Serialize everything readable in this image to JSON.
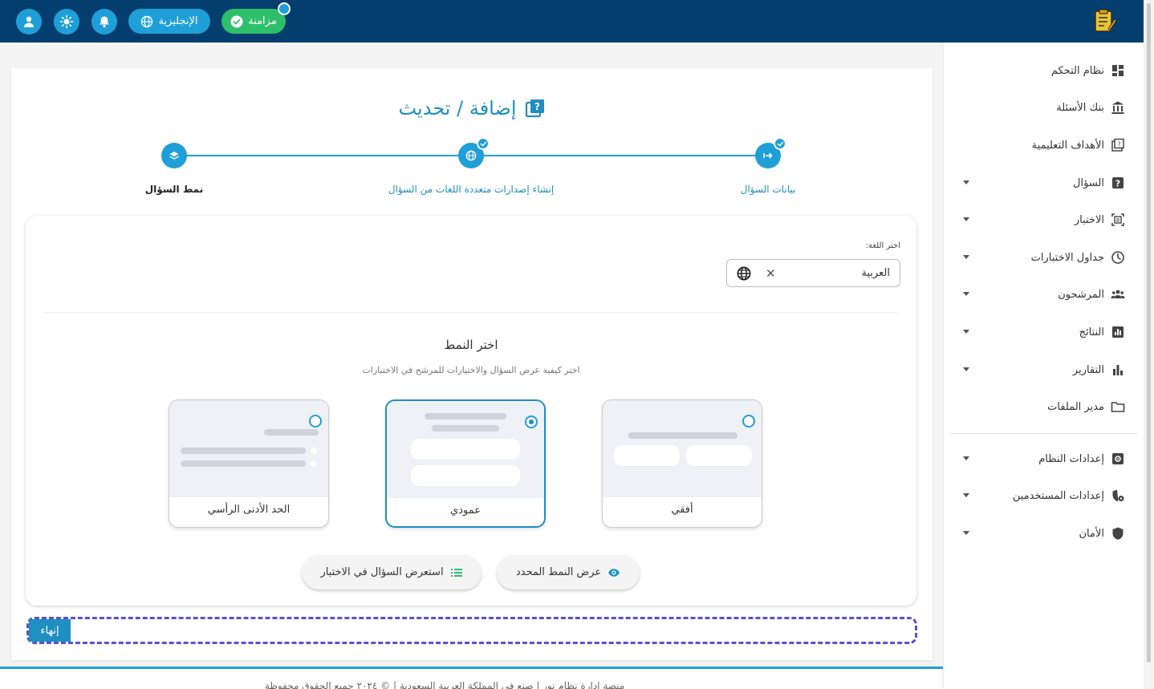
{
  "topbar": {
    "sync_label": "مزامنة",
    "language_label": "الإنجليزية",
    "icons": [
      "user-icon",
      "sun-icon",
      "bell-icon",
      "globe-icon",
      "check-icon"
    ]
  },
  "sidebar": {
    "items": [
      {
        "label": "نظام التحكم",
        "icon": "dashboard-icon",
        "expandable": false
      },
      {
        "label": "بنك الأسئلة",
        "icon": "bank-icon",
        "expandable": false
      },
      {
        "label": "الأهداف التعليمية",
        "icon": "objectives-icon",
        "expandable": false
      },
      {
        "label": "السؤال",
        "icon": "question-icon",
        "expandable": true
      },
      {
        "label": "الاختبار",
        "icon": "exam-icon",
        "expandable": true
      },
      {
        "label": "جداول الاختبارات",
        "icon": "clock-icon",
        "expandable": true
      },
      {
        "label": "المرشحون",
        "icon": "people-icon",
        "expandable": true
      },
      {
        "label": "النتائج",
        "icon": "results-icon",
        "expandable": true
      },
      {
        "label": "التقارير",
        "icon": "reports-icon",
        "expandable": true
      },
      {
        "label": "مدير الملفات",
        "icon": "folder-icon",
        "expandable": false
      },
      {
        "label": "إعدادات النظام",
        "icon": "settings-icon",
        "expandable": true
      },
      {
        "label": "إعدادات المستخدمين",
        "icon": "user-settings-icon",
        "expandable": true
      },
      {
        "label": "الأمان",
        "icon": "shield-icon",
        "expandable": true
      }
    ]
  },
  "page": {
    "title": "إضافة / تحديث"
  },
  "stepper": {
    "steps": [
      {
        "label": "بيانات السؤال",
        "state": "done"
      },
      {
        "label": "إنشاء إصدارات متعددة اللغات من السؤال",
        "state": "done"
      },
      {
        "label": "نمط السؤال",
        "state": "active"
      }
    ]
  },
  "form": {
    "language_label": "اختر اللغة:",
    "language_value": "العربية",
    "choose_title": "اختر النمط",
    "choose_subtitle": "اختر كيفية عرض السؤال والاختيارات للمرشح في الاختبارات",
    "options": [
      {
        "label": "أفقي",
        "selected": false
      },
      {
        "label": "عمودي",
        "selected": true
      },
      {
        "label": "الحد الأدنى الرأسي",
        "selected": false
      }
    ],
    "preview_selected_label": "عرض النمط المحدد",
    "preview_in_exam_label": "استعرض السؤال في الاختبار",
    "finish_label": "إنهاء"
  },
  "footer": {
    "text": "منصة إدارة نظام نور | صنع في المملكة العربية السعودية | © ٢٠٢٤ جميع الحقوق محفوظة"
  },
  "colors": {
    "header": "#033e6e",
    "accent": "#1f9fd8",
    "sync_green": "#2ebf6a",
    "focus_dashed": "#5a4fcf"
  }
}
